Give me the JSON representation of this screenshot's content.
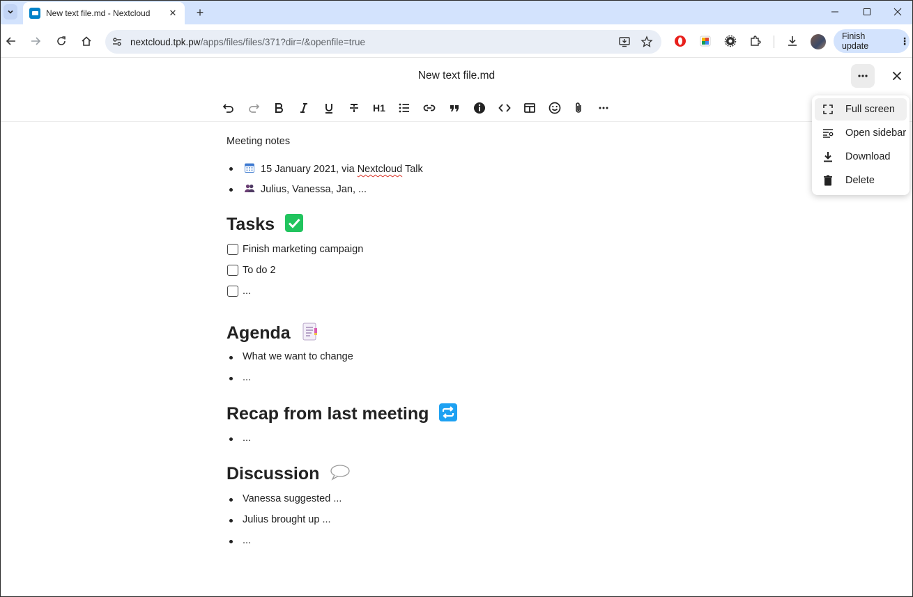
{
  "browser": {
    "tab": {
      "title": "New text file.md - Nextcloud",
      "favicon": "nextcloud-folder-icon"
    },
    "url": {
      "host": "nextcloud.tpk.pw",
      "path": "/apps/files/files/371?dir=/&openfile=true"
    },
    "finish_update_label": "Finish update"
  },
  "app": {
    "document_title": "New text file.md",
    "menu": {
      "items": [
        {
          "label": "Full screen",
          "icon": "fullscreen-icon"
        },
        {
          "label": "Open sidebar",
          "icon": "sidebar-icon"
        },
        {
          "label": "Download",
          "icon": "download-icon"
        },
        {
          "label": "Delete",
          "icon": "trash-icon"
        }
      ]
    },
    "format_toolbar": {
      "heading_label": "H1"
    }
  },
  "document": {
    "intro": "Meeting notes",
    "meta": [
      {
        "text_before": "15 January 2021, via ",
        "link": "Nextcloud",
        "text_after": " Talk",
        "icon": "calendar-emoji"
      },
      {
        "text": "Julius, Vanessa, Jan, ...",
        "icon": "people-emoji"
      }
    ],
    "tasks_heading": "Tasks",
    "tasks": [
      "Finish marketing campaign",
      "To do 2",
      "..."
    ],
    "agenda_heading": "Agenda",
    "agenda_items": [
      "What we want to change",
      "..."
    ],
    "recap_heading": "Recap from last meeting",
    "recap_items": [
      "..."
    ],
    "discussion_heading": "Discussion",
    "discussion_items": [
      "Vanessa suggested ...",
      "Julius brought up ...",
      "..."
    ]
  },
  "colors": {
    "tab_strip": "#d3e3fd",
    "nextcloud_blue": "#0082c9",
    "check_green": "#21c45e",
    "repeat_blue": "#1da1f2"
  }
}
